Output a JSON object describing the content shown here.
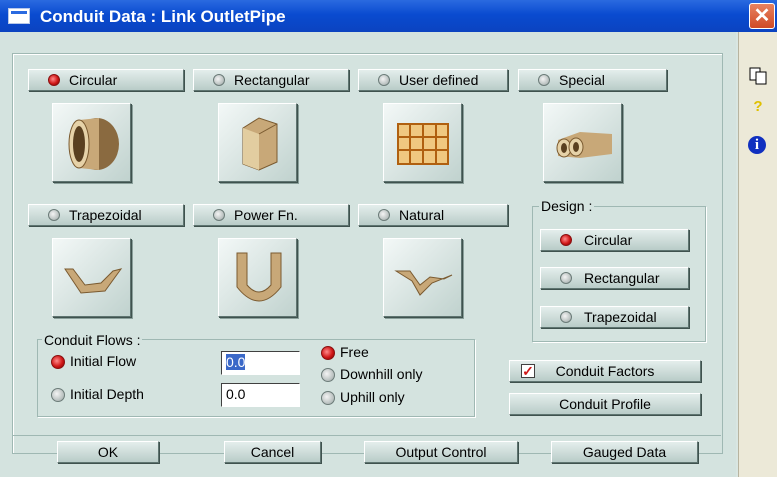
{
  "window": {
    "title": "Conduit Data : Link OutletPipe",
    "close_glyph": "✕"
  },
  "shapes": [
    {
      "id": "circular",
      "label": "Circular",
      "selected": true
    },
    {
      "id": "rectangular",
      "label": "Rectangular",
      "selected": false
    },
    {
      "id": "user-defined",
      "label": "User defined",
      "selected": false
    },
    {
      "id": "special",
      "label": "Special",
      "selected": false
    },
    {
      "id": "trapezoidal",
      "label": "Trapezoidal",
      "selected": false
    },
    {
      "id": "power-fn",
      "label": "Power Fn.",
      "selected": false
    },
    {
      "id": "natural",
      "label": "Natural",
      "selected": false
    }
  ],
  "design": {
    "label": "Design :",
    "options": [
      {
        "label": "Circular",
        "selected": true
      },
      {
        "label": "Rectangular",
        "selected": false
      },
      {
        "label": "Trapezoidal",
        "selected": false
      }
    ]
  },
  "flows": {
    "label": "Conduit Flows :",
    "initial_flow": {
      "label": "Initial Flow",
      "value": "0.0",
      "selected": true
    },
    "initial_depth": {
      "label": "Initial Depth",
      "value": "0.0",
      "selected": false
    },
    "direction": [
      {
        "label": "Free",
        "selected": true
      },
      {
        "label": "Downhill only",
        "selected": false
      },
      {
        "label": "Uphill only",
        "selected": false
      }
    ]
  },
  "factors": {
    "label": "Conduit Factors",
    "checked": true,
    "check_glyph": "✓"
  },
  "profile": {
    "label": "Conduit Profile"
  },
  "footer": {
    "ok": "OK",
    "cancel": "Cancel",
    "output": "Output Control",
    "gauged": "Gauged Data"
  },
  "sidebar": {
    "copy_icon": "copy-icon",
    "help_icon": "help-icon",
    "help_glyph": "?",
    "info_icon": "info-icon",
    "info_glyph": "i"
  },
  "colors": {
    "title_bar": "#0a4bd0",
    "radio_selected": "#d01818",
    "dialog_bg": "#d4e3df"
  }
}
